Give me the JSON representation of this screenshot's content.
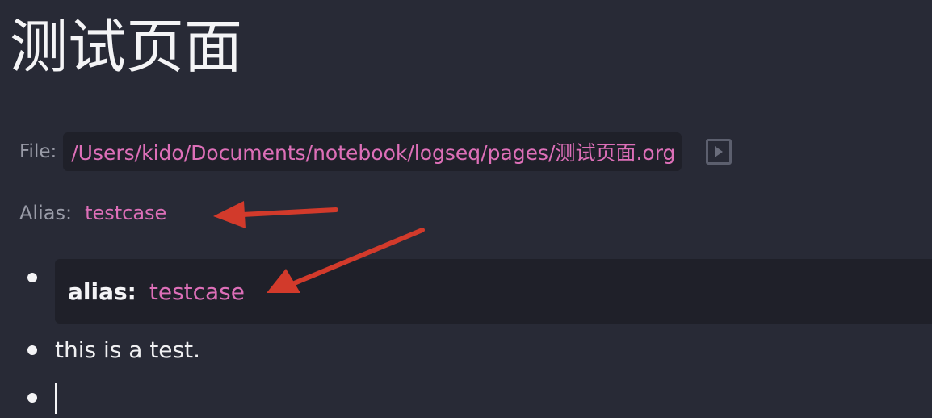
{
  "page": {
    "title": "测试页面"
  },
  "file": {
    "label": "File:",
    "path": "/Users/kido/Documents/notebook/logseq/pages/测试页面.org",
    "open_icon": "play-icon"
  },
  "alias": {
    "label": "Alias:",
    "value": "testcase"
  },
  "blocks": [
    {
      "property_key": "alias:",
      "property_value": "testcase"
    },
    {
      "text": "this is a test."
    },
    {
      "text": ""
    }
  ],
  "colors": {
    "background": "#282a36",
    "link": "#dd6fb8",
    "annotation_arrow": "#d23a2b"
  }
}
